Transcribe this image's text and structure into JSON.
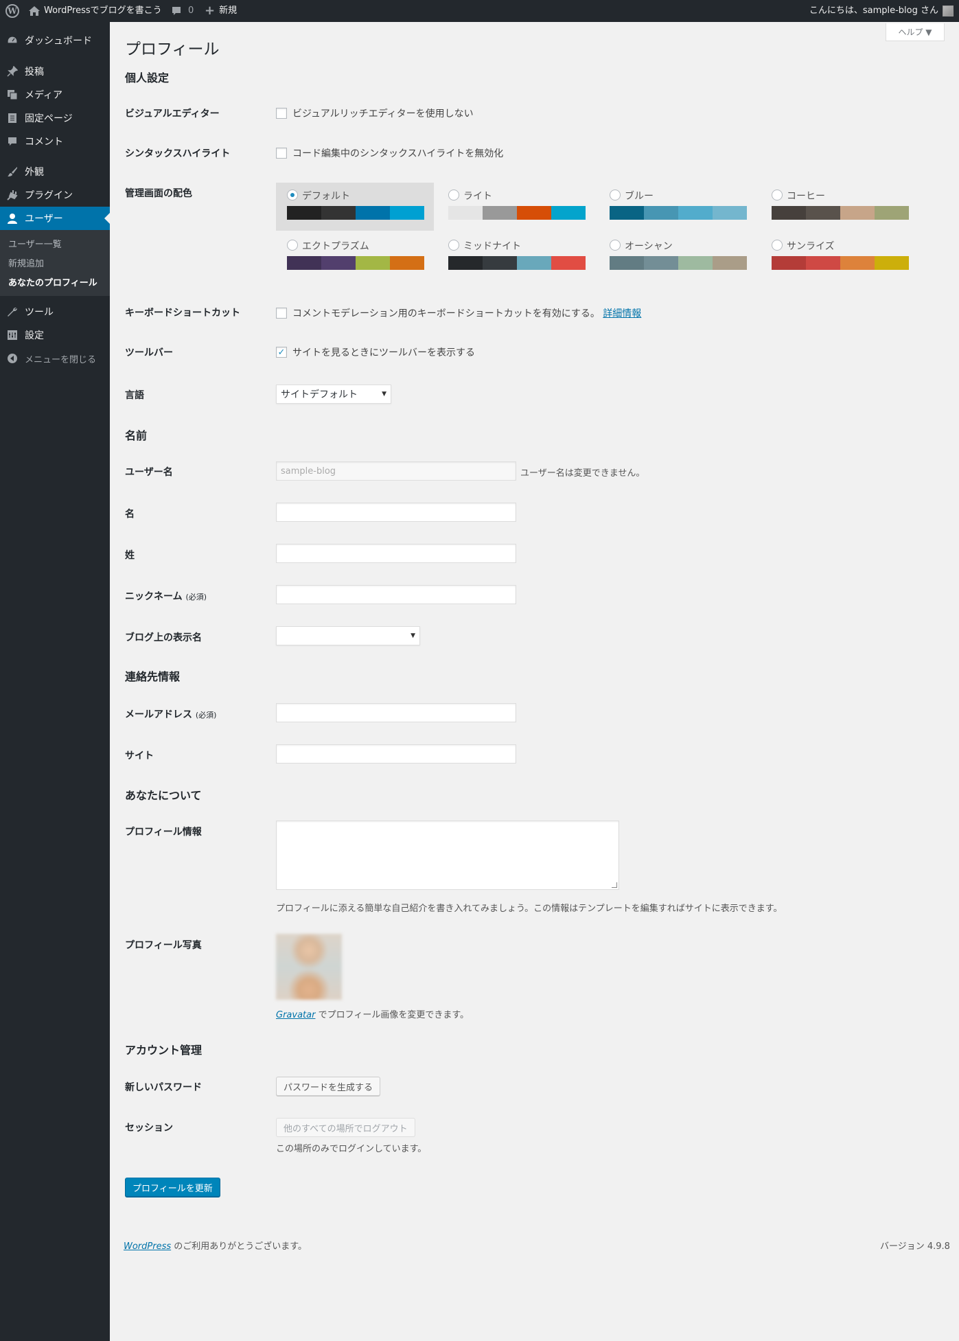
{
  "adminbar": {
    "site_name": "WordPressでブログを書こう",
    "comments_count": "0",
    "new_label": "新規",
    "greeting": "こんにちは、sample-blog さん"
  },
  "menu": {
    "dashboard": "ダッシュボード",
    "posts": "投稿",
    "media": "メディア",
    "pages": "固定ページ",
    "comments": "コメント",
    "appearance": "外観",
    "plugins": "プラグイン",
    "users": "ユーザー",
    "users_sub": [
      "ユーザー一覧",
      "新規追加",
      "あなたのプロフィール"
    ],
    "tools": "ツール",
    "settings": "設定",
    "collapse": "メニューを閉じる"
  },
  "help_label": "ヘルプ ▼",
  "page_title": "プロフィール",
  "personal": {
    "title": "個人設定",
    "visual_editor_label": "ビジュアルエディター",
    "visual_editor_text": "ビジュアルリッチエディターを使用しない",
    "syntax_label": "シンタックスハイライト",
    "syntax_text": "コード編集中のシンタックスハイライトを無効化",
    "color_label": "管理画面の配色",
    "schemes": [
      {
        "name": "デフォルト",
        "colors": [
          "#222222",
          "#333333",
          "#0073aa",
          "#00a0d2"
        ],
        "selected": true
      },
      {
        "name": "ライト",
        "colors": [
          "#e5e5e5",
          "#999999",
          "#d64e07",
          "#04a4cc"
        ],
        "selected": false
      },
      {
        "name": "ブルー",
        "colors": [
          "#096484",
          "#4796b3",
          "#52accc",
          "#74b6ce"
        ],
        "selected": false
      },
      {
        "name": "コーヒー",
        "colors": [
          "#46403c",
          "#59524c",
          "#c7a589",
          "#9ea476"
        ],
        "selected": false
      },
      {
        "name": "エクトプラズム",
        "colors": [
          "#413256",
          "#523f6d",
          "#a3b745",
          "#d46f15"
        ],
        "selected": false
      },
      {
        "name": "ミッドナイト",
        "colors": [
          "#25282b",
          "#363b3f",
          "#69a8bb",
          "#e14d43"
        ],
        "selected": false
      },
      {
        "name": "オーシャン",
        "colors": [
          "#627c83",
          "#738e96",
          "#9ebaa0",
          "#aa9d88"
        ],
        "selected": false
      },
      {
        "name": "サンライズ",
        "colors": [
          "#b43c38",
          "#cf4944",
          "#dd823b",
          "#ccaf0b"
        ],
        "selected": false
      }
    ],
    "shortcuts_label": "キーボードショートカット",
    "shortcuts_text": "コメントモデレーション用のキーボードショートカットを有効にする。",
    "shortcuts_link": "詳細情報",
    "toolbar_label": "ツールバー",
    "toolbar_text": "サイトを見るときにツールバーを表示する",
    "toolbar_checked": "✓",
    "language_label": "言語",
    "language_value": "サイトデフォルト"
  },
  "name": {
    "title": "名前",
    "username_label": "ユーザー名",
    "username_value": "sample-blog",
    "username_note": "ユーザー名は変更できません。",
    "first_label": "名",
    "last_label": "姓",
    "nickname_label": "ニックネーム",
    "required": "(必須)",
    "display_label": "ブログ上の表示名"
  },
  "contact": {
    "title": "連絡先情報",
    "email_label": "メールアドレス",
    "required": "(必須)",
    "site_label": "サイト"
  },
  "about": {
    "title": "あなたについて",
    "bio_label": "プロフィール情報",
    "bio_desc": "プロフィールに添える簡単な自己紹介を書き入れてみましょう。この情報はテンプレートを編集すればサイトに表示できます。",
    "photo_label": "プロフィール写真",
    "gravatar_link": "Gravatar",
    "gravatar_text": " でプロフィール画像を変更できます。"
  },
  "account": {
    "title": "アカウント管理",
    "password_label": "新しいパスワード",
    "password_button": "パスワードを生成する",
    "session_label": "セッション",
    "logout_button": "他のすべての場所でログアウト",
    "session_note": "この場所のみでログインしています。"
  },
  "submit_label": "プロフィールを更新",
  "footer": {
    "wp_link": "WordPress",
    "thanks": " のご利用ありがとうございます。",
    "version": "バージョン 4.9.8"
  }
}
